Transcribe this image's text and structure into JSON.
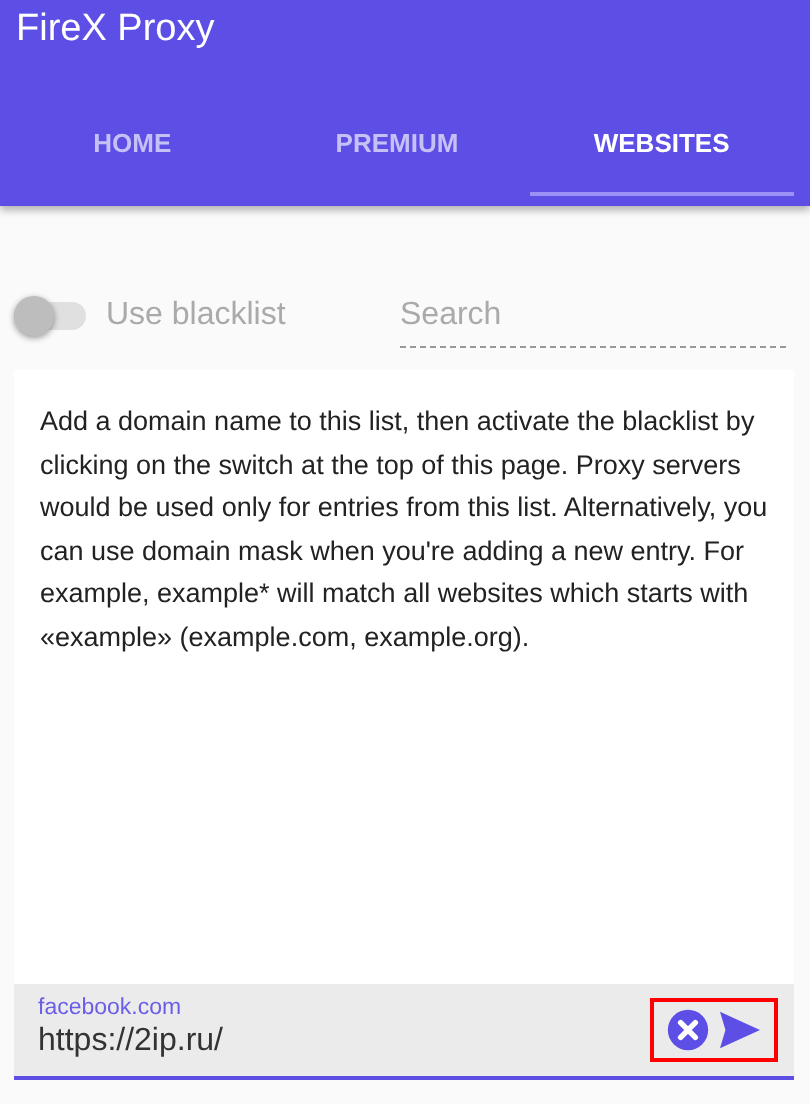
{
  "app_title": "FireX Proxy",
  "tabs": [
    {
      "label": "HOME",
      "selected": false
    },
    {
      "label": "PREMIUM",
      "selected": false
    },
    {
      "label": "WEBSITES",
      "selected": true
    }
  ],
  "blacklist_switch": {
    "label": "Use blacklist",
    "on": false
  },
  "search": {
    "placeholder": "Search"
  },
  "help_text": "Add a domain name to this list, then activate the blacklist by clicking on the switch at the top of this page. Proxy servers would be used only for entries from this list. Alternatively, you can use domain mask when you're adding a new entry. For example, example* will match all websites which starts with «example» (example.com, example.org).",
  "new_entry": {
    "label": "facebook.com",
    "value": "https://2ip.ru/"
  }
}
